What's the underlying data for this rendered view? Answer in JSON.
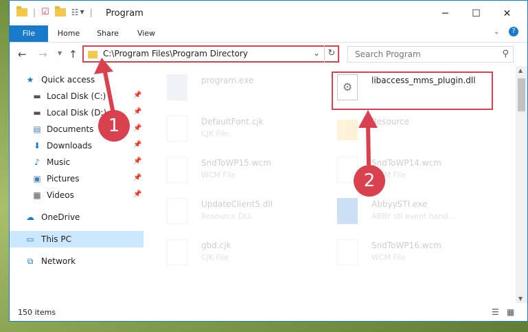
{
  "window": {
    "title": "Program"
  },
  "ribbon": {
    "tabs": [
      "File",
      "Home",
      "Share",
      "View"
    ]
  },
  "address": {
    "path": "C:\\Program Files\\Program Directory"
  },
  "search": {
    "placeholder": "Search Program"
  },
  "sidebar": {
    "items": [
      {
        "label": "Quick access",
        "icon": "star-icon"
      },
      {
        "label": "Local Disk (C:)",
        "icon": "drive-icon"
      },
      {
        "label": "Local Disk (D:)",
        "icon": "drive-icon"
      },
      {
        "label": "Documents",
        "icon": "documents-icon"
      },
      {
        "label": "Downloads",
        "icon": "downloads-icon"
      },
      {
        "label": "Music",
        "icon": "music-icon"
      },
      {
        "label": "Pictures",
        "icon": "pictures-icon"
      },
      {
        "label": "Videos",
        "icon": "videos-icon"
      },
      {
        "label": "OneDrive",
        "icon": "cloud-icon"
      },
      {
        "label": "This PC",
        "icon": "computer-icon"
      },
      {
        "label": "Network",
        "icon": "network-icon"
      }
    ]
  },
  "files": [
    {
      "name": "program.exe",
      "type": ""
    },
    {
      "name": "libaccess_mms_plugin.dll",
      "type": ""
    },
    {
      "name": "DefaultFont.cjk",
      "type": "CJK File"
    },
    {
      "name": "Resource",
      "type": ""
    },
    {
      "name": "SndToWP15.wcm",
      "type": "WCM File"
    },
    {
      "name": "SndToWP14.wcm",
      "type": "WCM File"
    },
    {
      "name": "UpdateClient5.dll",
      "type": "Resource DLL"
    },
    {
      "name": "AbbyySTI.exe",
      "type": "ABBY sti event hand..."
    },
    {
      "name": "gbd.cjk",
      "type": "CJK File"
    },
    {
      "name": "SndToWP16.wcm",
      "type": "WCM File"
    }
  ],
  "status": {
    "item_count": "150 items"
  },
  "annotations": {
    "step1": "1",
    "step2": "2"
  },
  "colors": {
    "accent": "#1979ca",
    "annotation": "#d9414f",
    "selection": "#cce8ff"
  }
}
